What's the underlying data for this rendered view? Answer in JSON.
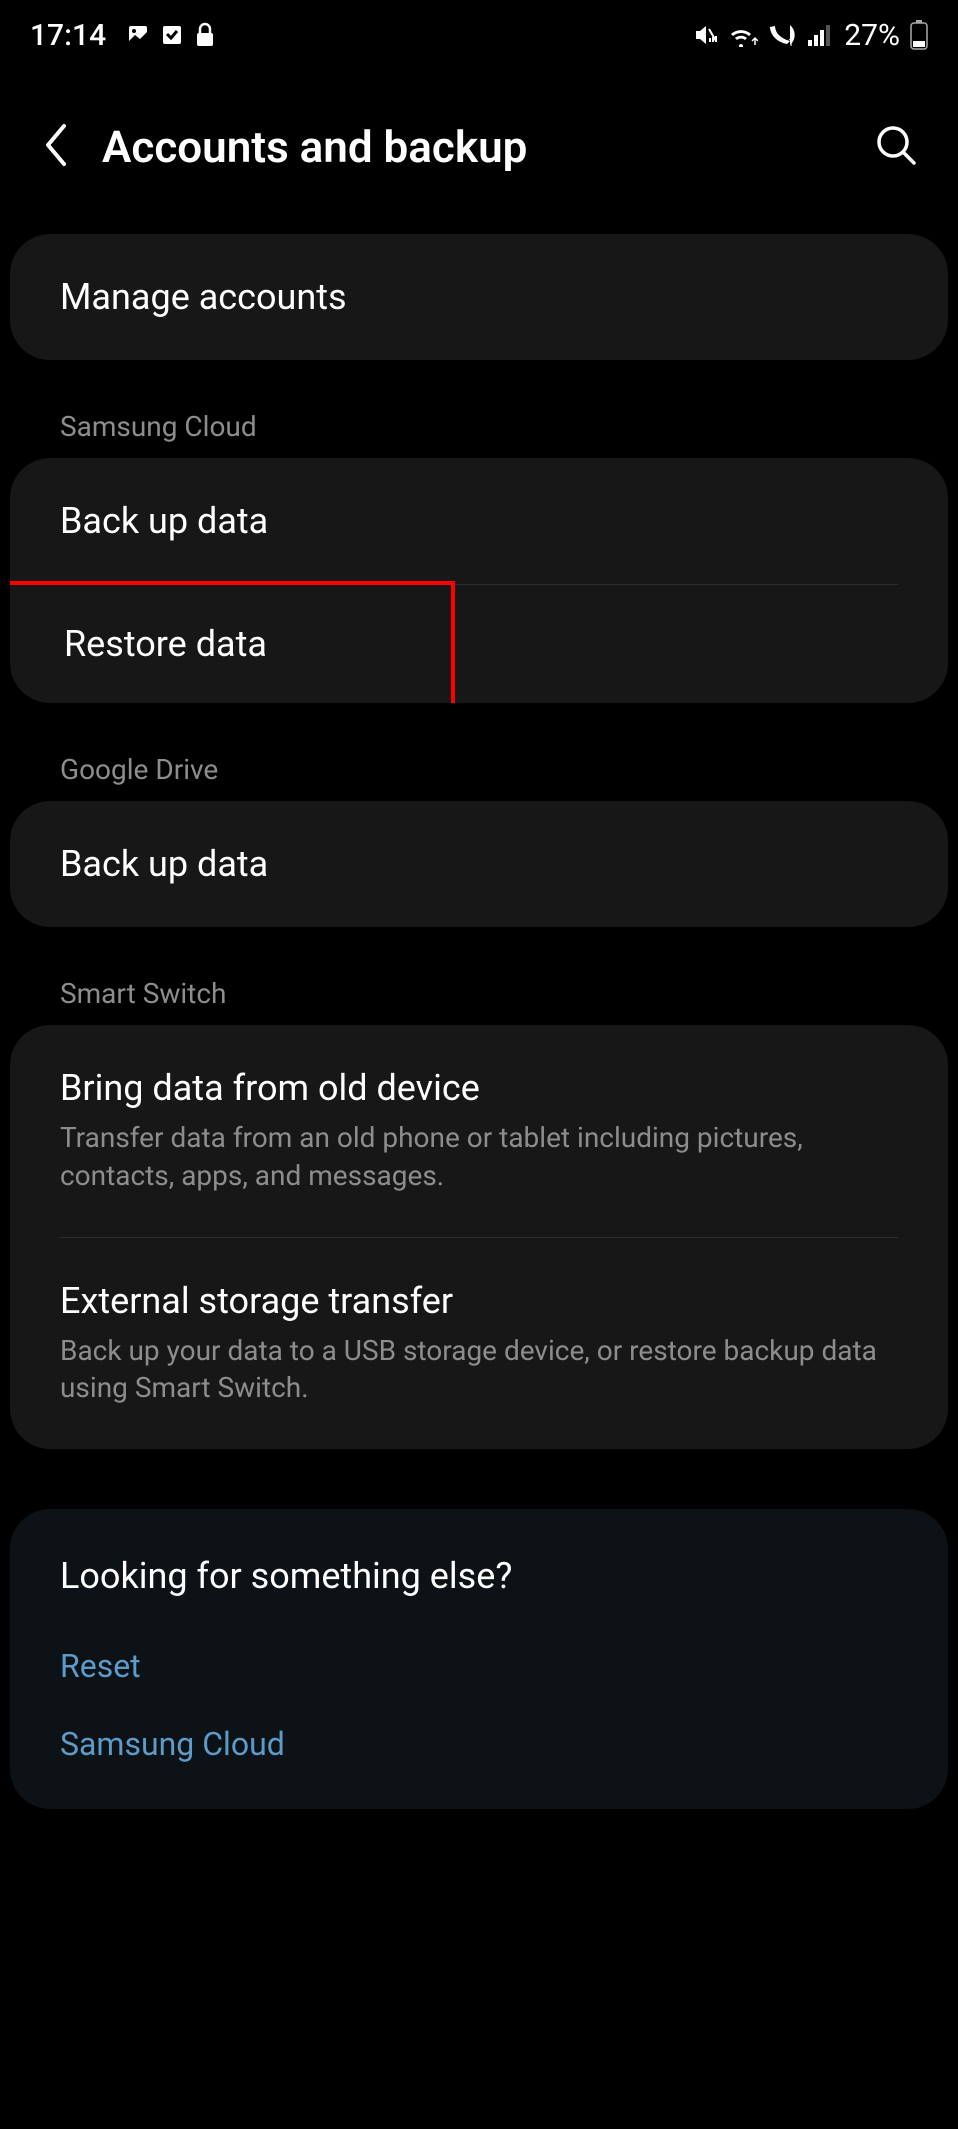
{
  "status": {
    "time": "17:14",
    "battery": "27%"
  },
  "header": {
    "title": "Accounts and backup"
  },
  "card1": {
    "item1": "Manage accounts"
  },
  "section1": {
    "label": "Samsung Cloud",
    "item1": "Back up data",
    "item2": "Restore data"
  },
  "section2": {
    "label": "Google Drive",
    "item1": "Back up data"
  },
  "section3": {
    "label": "Smart Switch",
    "item1_title": "Bring data from old device",
    "item1_sub": "Transfer data from an old phone or tablet including pictures, contacts, apps, and messages.",
    "item2_title": "External storage transfer",
    "item2_sub": "Back up your data to a USB storage device, or restore backup data using Smart Switch."
  },
  "footer": {
    "title": "Looking for something else?",
    "link1": "Reset",
    "link2": "Samsung Cloud"
  }
}
